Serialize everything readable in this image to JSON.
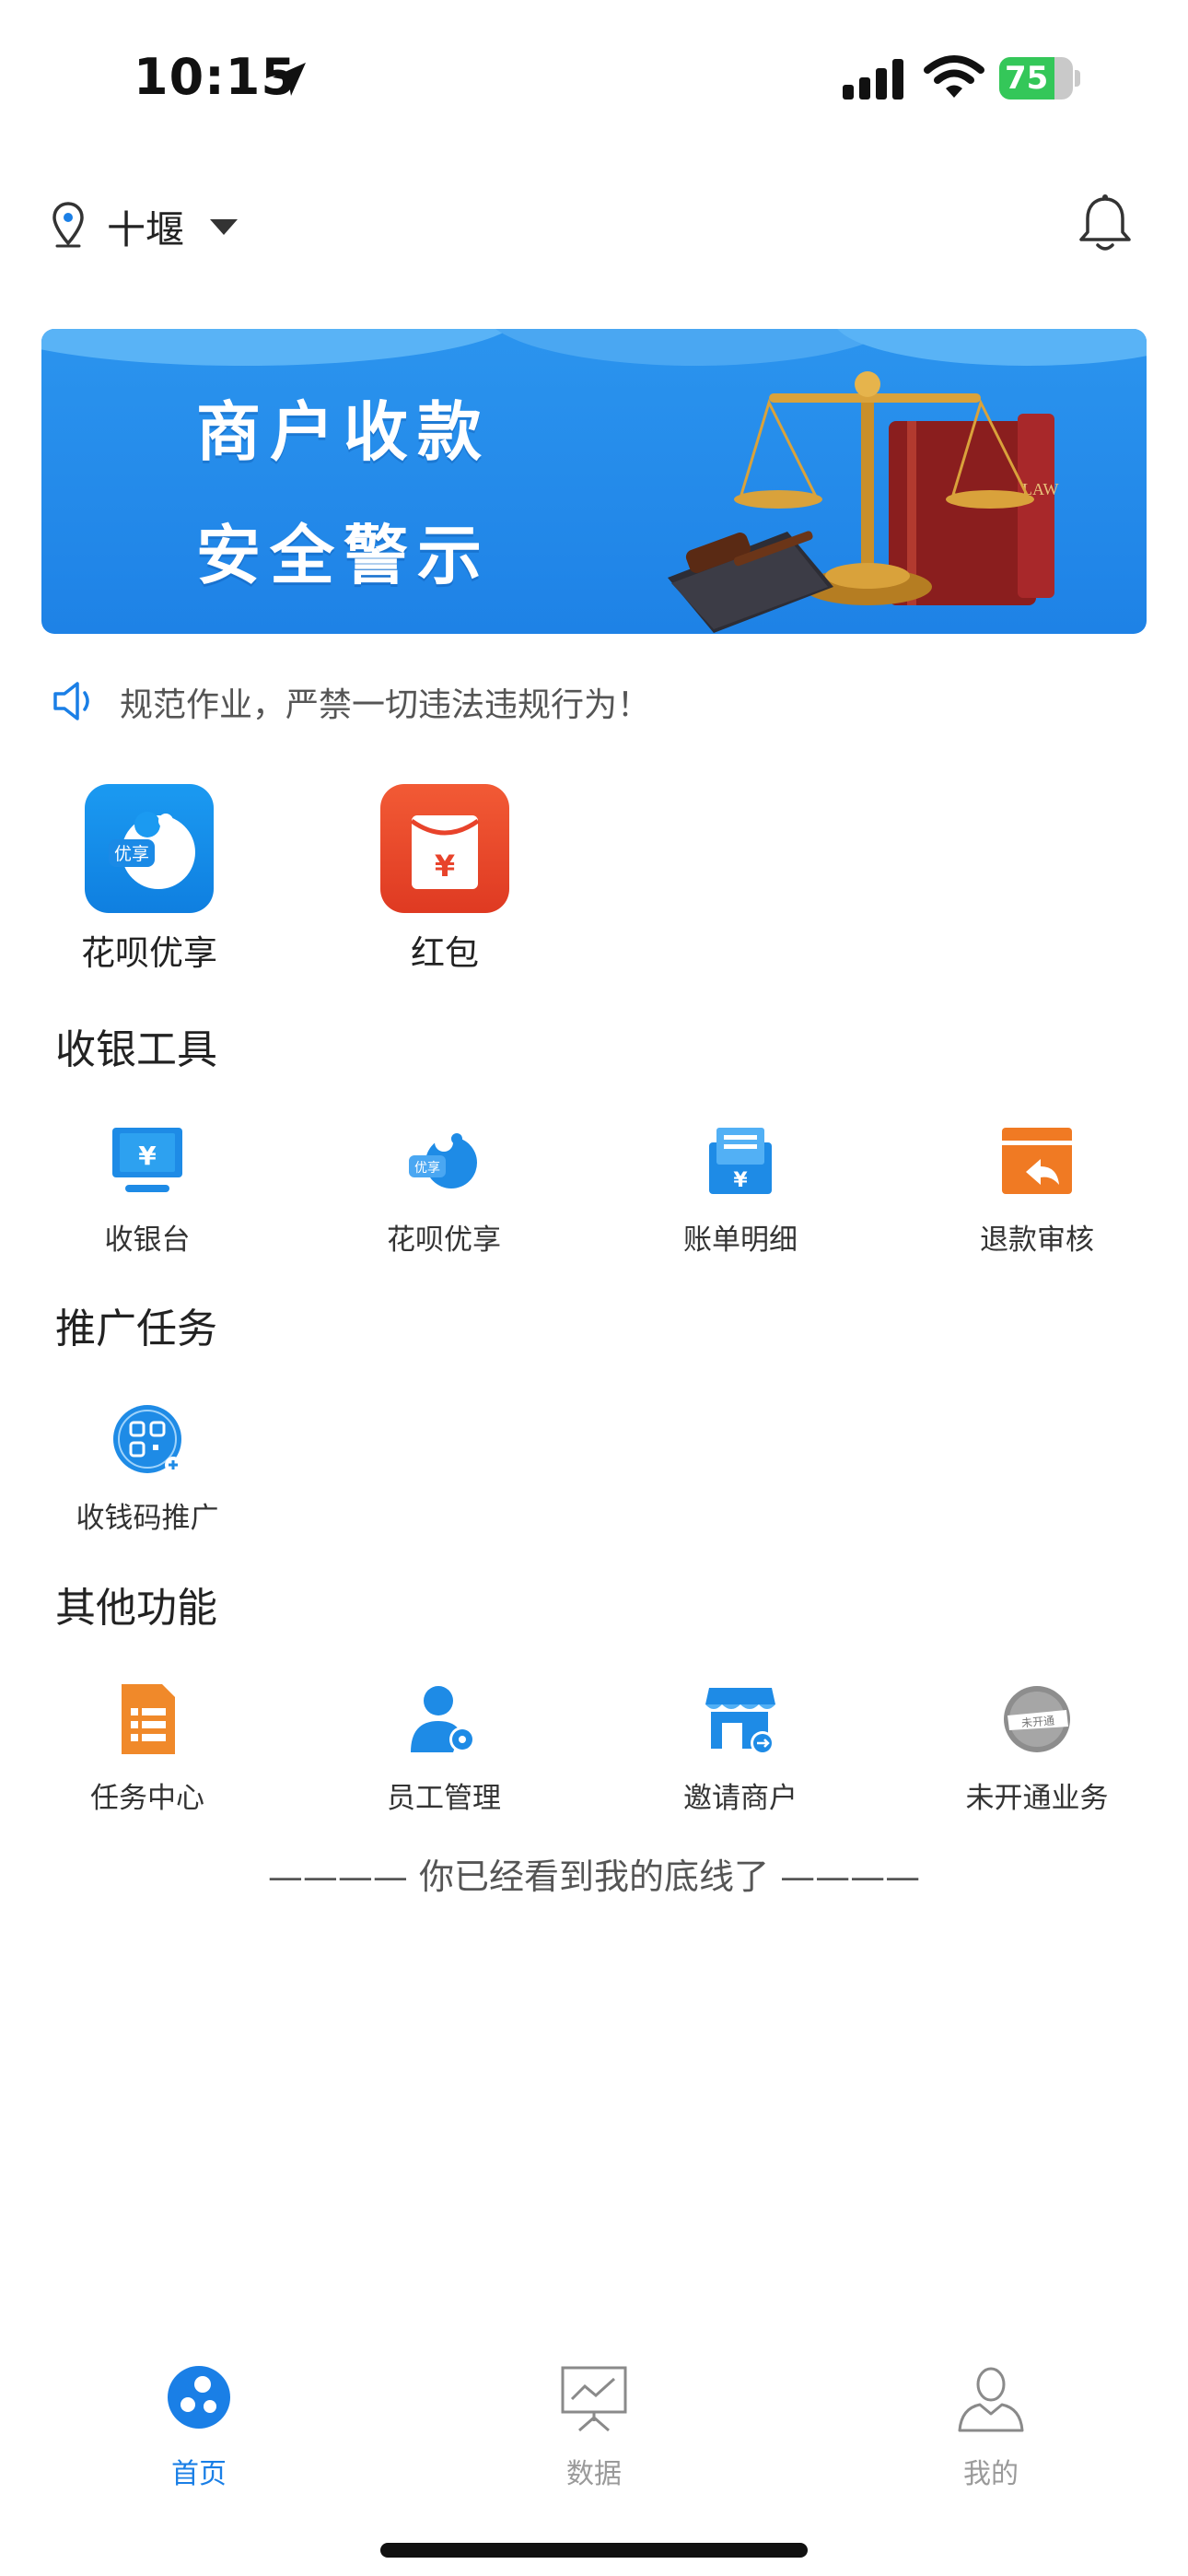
{
  "status_bar": {
    "time": "10:15",
    "battery": 75
  },
  "header": {
    "city": "十堰"
  },
  "banner": {
    "line1": "商户收款",
    "line2": "安全警示",
    "book_text": "LAW"
  },
  "notice": {
    "text": "规范作业，严禁一切违法违规行为！"
  },
  "featured_apps": [
    {
      "label": "花呗优享",
      "icon": "huabei-icon",
      "badge": "优享"
    },
    {
      "label": "红包",
      "icon": "red-envelope-icon",
      "badge": "¥"
    }
  ],
  "sections": {
    "cashier_tools": {
      "title": "收银工具",
      "items": [
        {
          "label": "收银台",
          "icon": "cashier-monitor-icon"
        },
        {
          "label": "花呗优享",
          "icon": "huabei-icon"
        },
        {
          "label": "账单明细",
          "icon": "bill-detail-icon"
        },
        {
          "label": "退款审核",
          "icon": "refund-review-icon"
        }
      ]
    },
    "promotion": {
      "title": "推广任务",
      "items": [
        {
          "label": "收钱码推广",
          "icon": "qr-promotion-icon"
        }
      ]
    },
    "other": {
      "title": "其他功能",
      "items": [
        {
          "label": "任务中心",
          "icon": "task-list-icon"
        },
        {
          "label": "员工管理",
          "icon": "staff-manage-icon"
        },
        {
          "label": "邀请商户",
          "icon": "invite-merchant-icon"
        },
        {
          "label": "未开通业务",
          "icon": "inactive-business-icon",
          "stamp": "未开通"
        }
      ]
    }
  },
  "bottom_line": {
    "text": "———— 你已经看到我的底线了 ————"
  },
  "tab_bar": {
    "items": [
      {
        "label": "首页",
        "icon": "home-bubbles-icon",
        "active": true
      },
      {
        "label": "数据",
        "icon": "chart-board-icon",
        "active": false
      },
      {
        "label": "我的",
        "icon": "person-icon",
        "active": false
      }
    ]
  },
  "colors": {
    "accent": "#1a7fe6",
    "red_envelope": "#e8432b",
    "orange": "#f07a23",
    "tab_inactive": "#9a9a9a"
  }
}
